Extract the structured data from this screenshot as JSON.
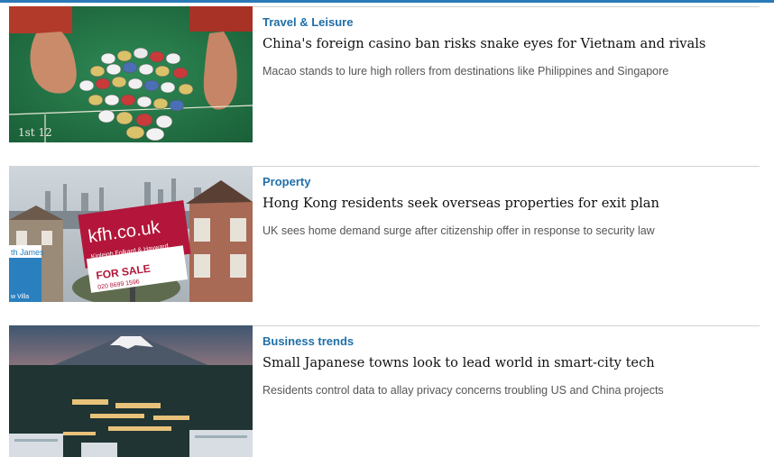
{
  "articles": [
    {
      "category": "Travel & Leisure",
      "headline": "China's foreign casino ban risks snake eyes for Vietnam and rivals",
      "summary": "Macao stands to lure high rollers from destinations like Philippines and Singapore",
      "image": {
        "table_label": "1st 12"
      }
    },
    {
      "category": "Property",
      "headline": "Hong Kong residents seek overseas properties for exit plan",
      "summary": "UK sees home demand surge after citizenship offer in response to security law",
      "image": {
        "sign_brand": "kfh.co.uk",
        "sign_company": "Kinleigh Folkard & Hayward",
        "sign_status": "FOR SALE",
        "sign_phone": "020 8699 1596",
        "side_sign_brand": "th James",
        "side_sign_extra": "w Villa"
      }
    },
    {
      "category": "Business trends",
      "headline": "Small Japanese towns look to lead world in smart-city tech",
      "summary": "Residents control data to allay privacy concerns troubling US and China projects",
      "image": {}
    }
  ],
  "colors": {
    "accent": "#1f6fa8",
    "top_bar": "#2a7ab8",
    "headline": "#111111",
    "summary": "#555555",
    "divider": "#d2d2d2"
  }
}
